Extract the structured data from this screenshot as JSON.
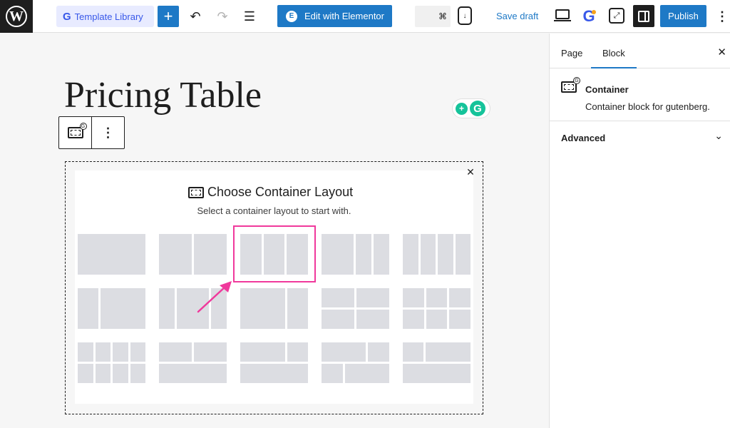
{
  "topbar": {
    "logo_glyph": "W",
    "template_library_icon": "G",
    "template_library_label": "Template Library",
    "add_glyph": "+",
    "undo_glyph": "↶",
    "redo_glyph": "↷",
    "outline_glyph": "☰",
    "elementor_logo": "E",
    "elementor_label": "Edit with Elementor",
    "command_glyph": "⌘",
    "device_glyph": "↓",
    "save_draft_label": "Save draft",
    "g_badge_glyph": "G",
    "nav_glyph": "⤢",
    "publish_label": "Publish",
    "kebab_glyph": "⋮",
    "accent": "#1e79c6"
  },
  "sidebar": {
    "tab_page": "Page",
    "tab_block": "Block",
    "close_glyph": "✕",
    "badge_glyph": "G",
    "block_name": "Container",
    "block_desc": "Container block for gutenberg.",
    "advanced_label": "Advanced",
    "chevron_glyph": "⌄"
  },
  "canvas": {
    "title": "Pricing Table",
    "toolbar_badge_glyph": "G",
    "toolbar_kebab_glyph": "⋮",
    "grammarly_bulb": "+",
    "grammarly_g": "G"
  },
  "picker": {
    "close_glyph": "✕",
    "title": "Choose Container Layout",
    "subtitle": "Select a container layout to start with.",
    "highlight_color": "#f0399c",
    "layouts": [
      "single-column",
      "two-equal-columns",
      "three-equal-columns",
      "one-half-two-quarters",
      "four-equal-columns",
      "one-third-two-thirds",
      "quarter-half-quarter",
      "two-thirds-one-third",
      "two-rows-two-columns",
      "two-rows-three-columns",
      "two-rows-four-columns",
      "two-columns-above-full-row",
      "full-row-above-two-columns",
      "two-thirds-third-above-third-two-thirds",
      "third-two-thirds-above-full-row"
    ],
    "highlighted_layout": "three-equal-columns"
  }
}
